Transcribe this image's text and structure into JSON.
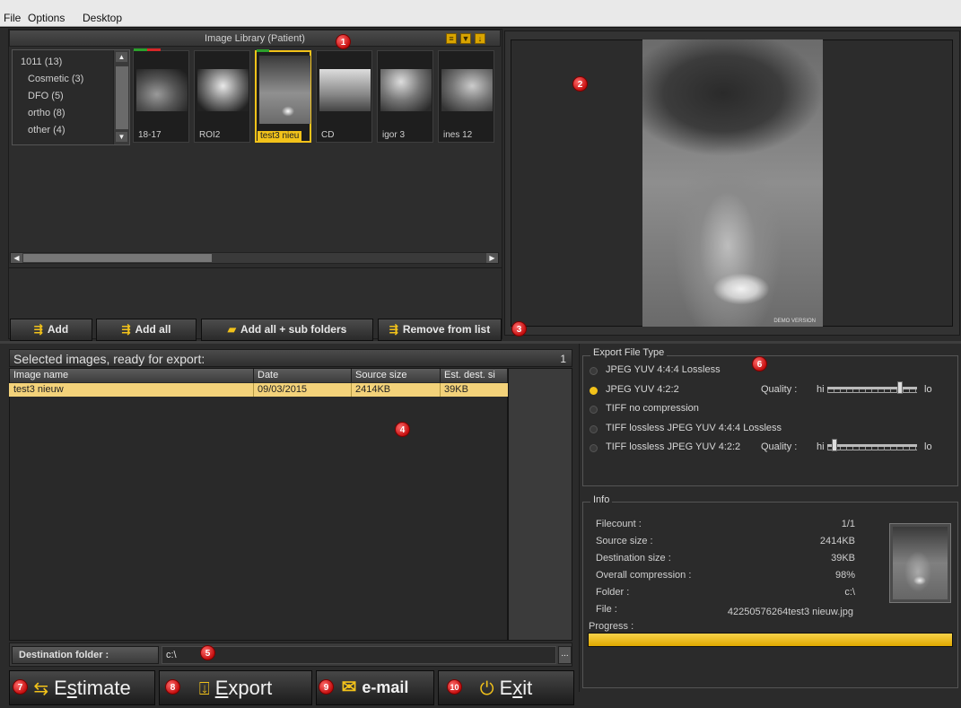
{
  "menu": [
    "File",
    "Options",
    "Desktop"
  ],
  "library": {
    "title": "Image Library (Patient)",
    "toolbar_icons": [
      "list-icon",
      "filter-icon",
      "download-icon"
    ],
    "tree": [
      "1011 (13)",
      "Cosmetic (3)",
      "DFO (5)",
      "ortho (8)",
      "other (4)"
    ],
    "thumbnails": [
      {
        "label": "18-17",
        "selected": false
      },
      {
        "label": "ROI2",
        "selected": false
      },
      {
        "label": "test3 nieu",
        "selected": true
      },
      {
        "label": "CD",
        "selected": false
      },
      {
        "label": "igor 3",
        "selected": false
      },
      {
        "label": "ines 12",
        "selected": false
      }
    ],
    "buttons": {
      "add": "Add",
      "add_all": "Add all",
      "add_all_sub": "Add all + sub folders",
      "remove": "Remove from list"
    }
  },
  "preview": {
    "watermark": "DEMO VERSION"
  },
  "selected": {
    "header": "Selected images, ready for export:",
    "count": "1",
    "columns": [
      "Image name",
      "Date",
      "Source size",
      "Est. dest. si"
    ],
    "rows": [
      {
        "name": "test3 nieuw",
        "date": "09/03/2015",
        "source": "2414KB",
        "dest": "39KB"
      }
    ]
  },
  "destination": {
    "label": "Destination folder :",
    "value": "c:\\",
    "browse": "..."
  },
  "bottom_buttons": {
    "estimate": {
      "pre": "E",
      "u": "s",
      "post": "timate"
    },
    "export": {
      "pre": "",
      "u": "E",
      "post": "xport"
    },
    "email": {
      "pre": "e-mail",
      "u": "",
      "post": ""
    },
    "exit": {
      "pre": "E",
      "u": "x",
      "post": "it"
    }
  },
  "export_type": {
    "title": "Export File Type",
    "options": [
      "JPEG YUV 4:4:4 Lossless",
      "JPEG YUV 4:2:2",
      "TIFF no compression",
      "TIFF lossless JPEG YUV 4:4:4 Lossless",
      "TIFF lossless JPEG YUV 4:2:2"
    ],
    "selected_index": 1,
    "quality_label": "Quality :",
    "hi": "hi",
    "lo": "lo",
    "quality_1": 0.83,
    "quality_2": 0.05
  },
  "info": {
    "title": "Info",
    "filecount_label": "Filecount :",
    "filecount": "1/1",
    "source_label": "Source size :",
    "source": "2414KB",
    "dest_label": "Destination size :",
    "dest": "39KB",
    "compression_label": "Overall compression :",
    "compression": "98%",
    "folder_label": "Folder :",
    "folder": "c:\\",
    "file_label": "File :",
    "file": "42250576264test3 nieuw.jpg",
    "progress_label": "Progress :",
    "progress": 1.0
  },
  "callouts": [
    "1",
    "2",
    "3",
    "4",
    "5",
    "6",
    "7",
    "8",
    "9",
    "10"
  ],
  "colors": {
    "accent": "#f2c21a",
    "callout": "#d11a1a",
    "selected_row": "#f3d27a"
  }
}
